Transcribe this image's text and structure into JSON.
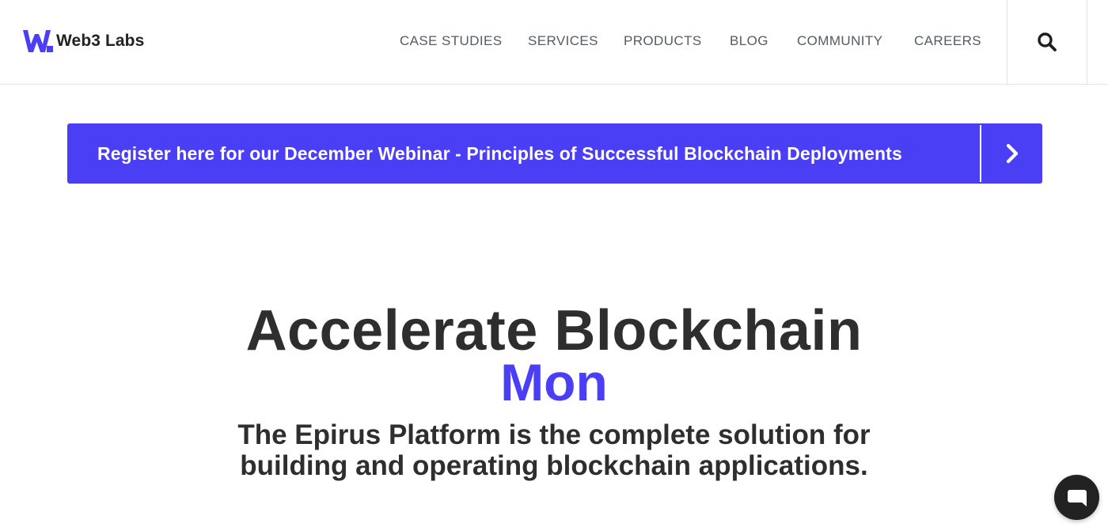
{
  "header": {
    "brand_name": "Web3 Labs",
    "brand_color": "#4b3ff5",
    "nav": [
      {
        "label": "CASE STUDIES"
      },
      {
        "label": "SERVICES"
      },
      {
        "label": "PRODUCTS"
      },
      {
        "label": "BLOG"
      },
      {
        "label": "COMMUNITY"
      },
      {
        "label": "CAREERS"
      }
    ],
    "search_icon": "search-icon"
  },
  "banner": {
    "text": "Register here for our December Webinar - Principles of Successful Blockchain Deployments",
    "icon": "chevron-right-icon",
    "background": "#4b3ff5"
  },
  "hero": {
    "title": "Accelerate Blockchain",
    "accent": "Mon",
    "subtitle": "The Epirus Platform is the complete solution for building and operating blockchain applications."
  },
  "chat": {
    "icon": "chat-bubble-icon"
  }
}
